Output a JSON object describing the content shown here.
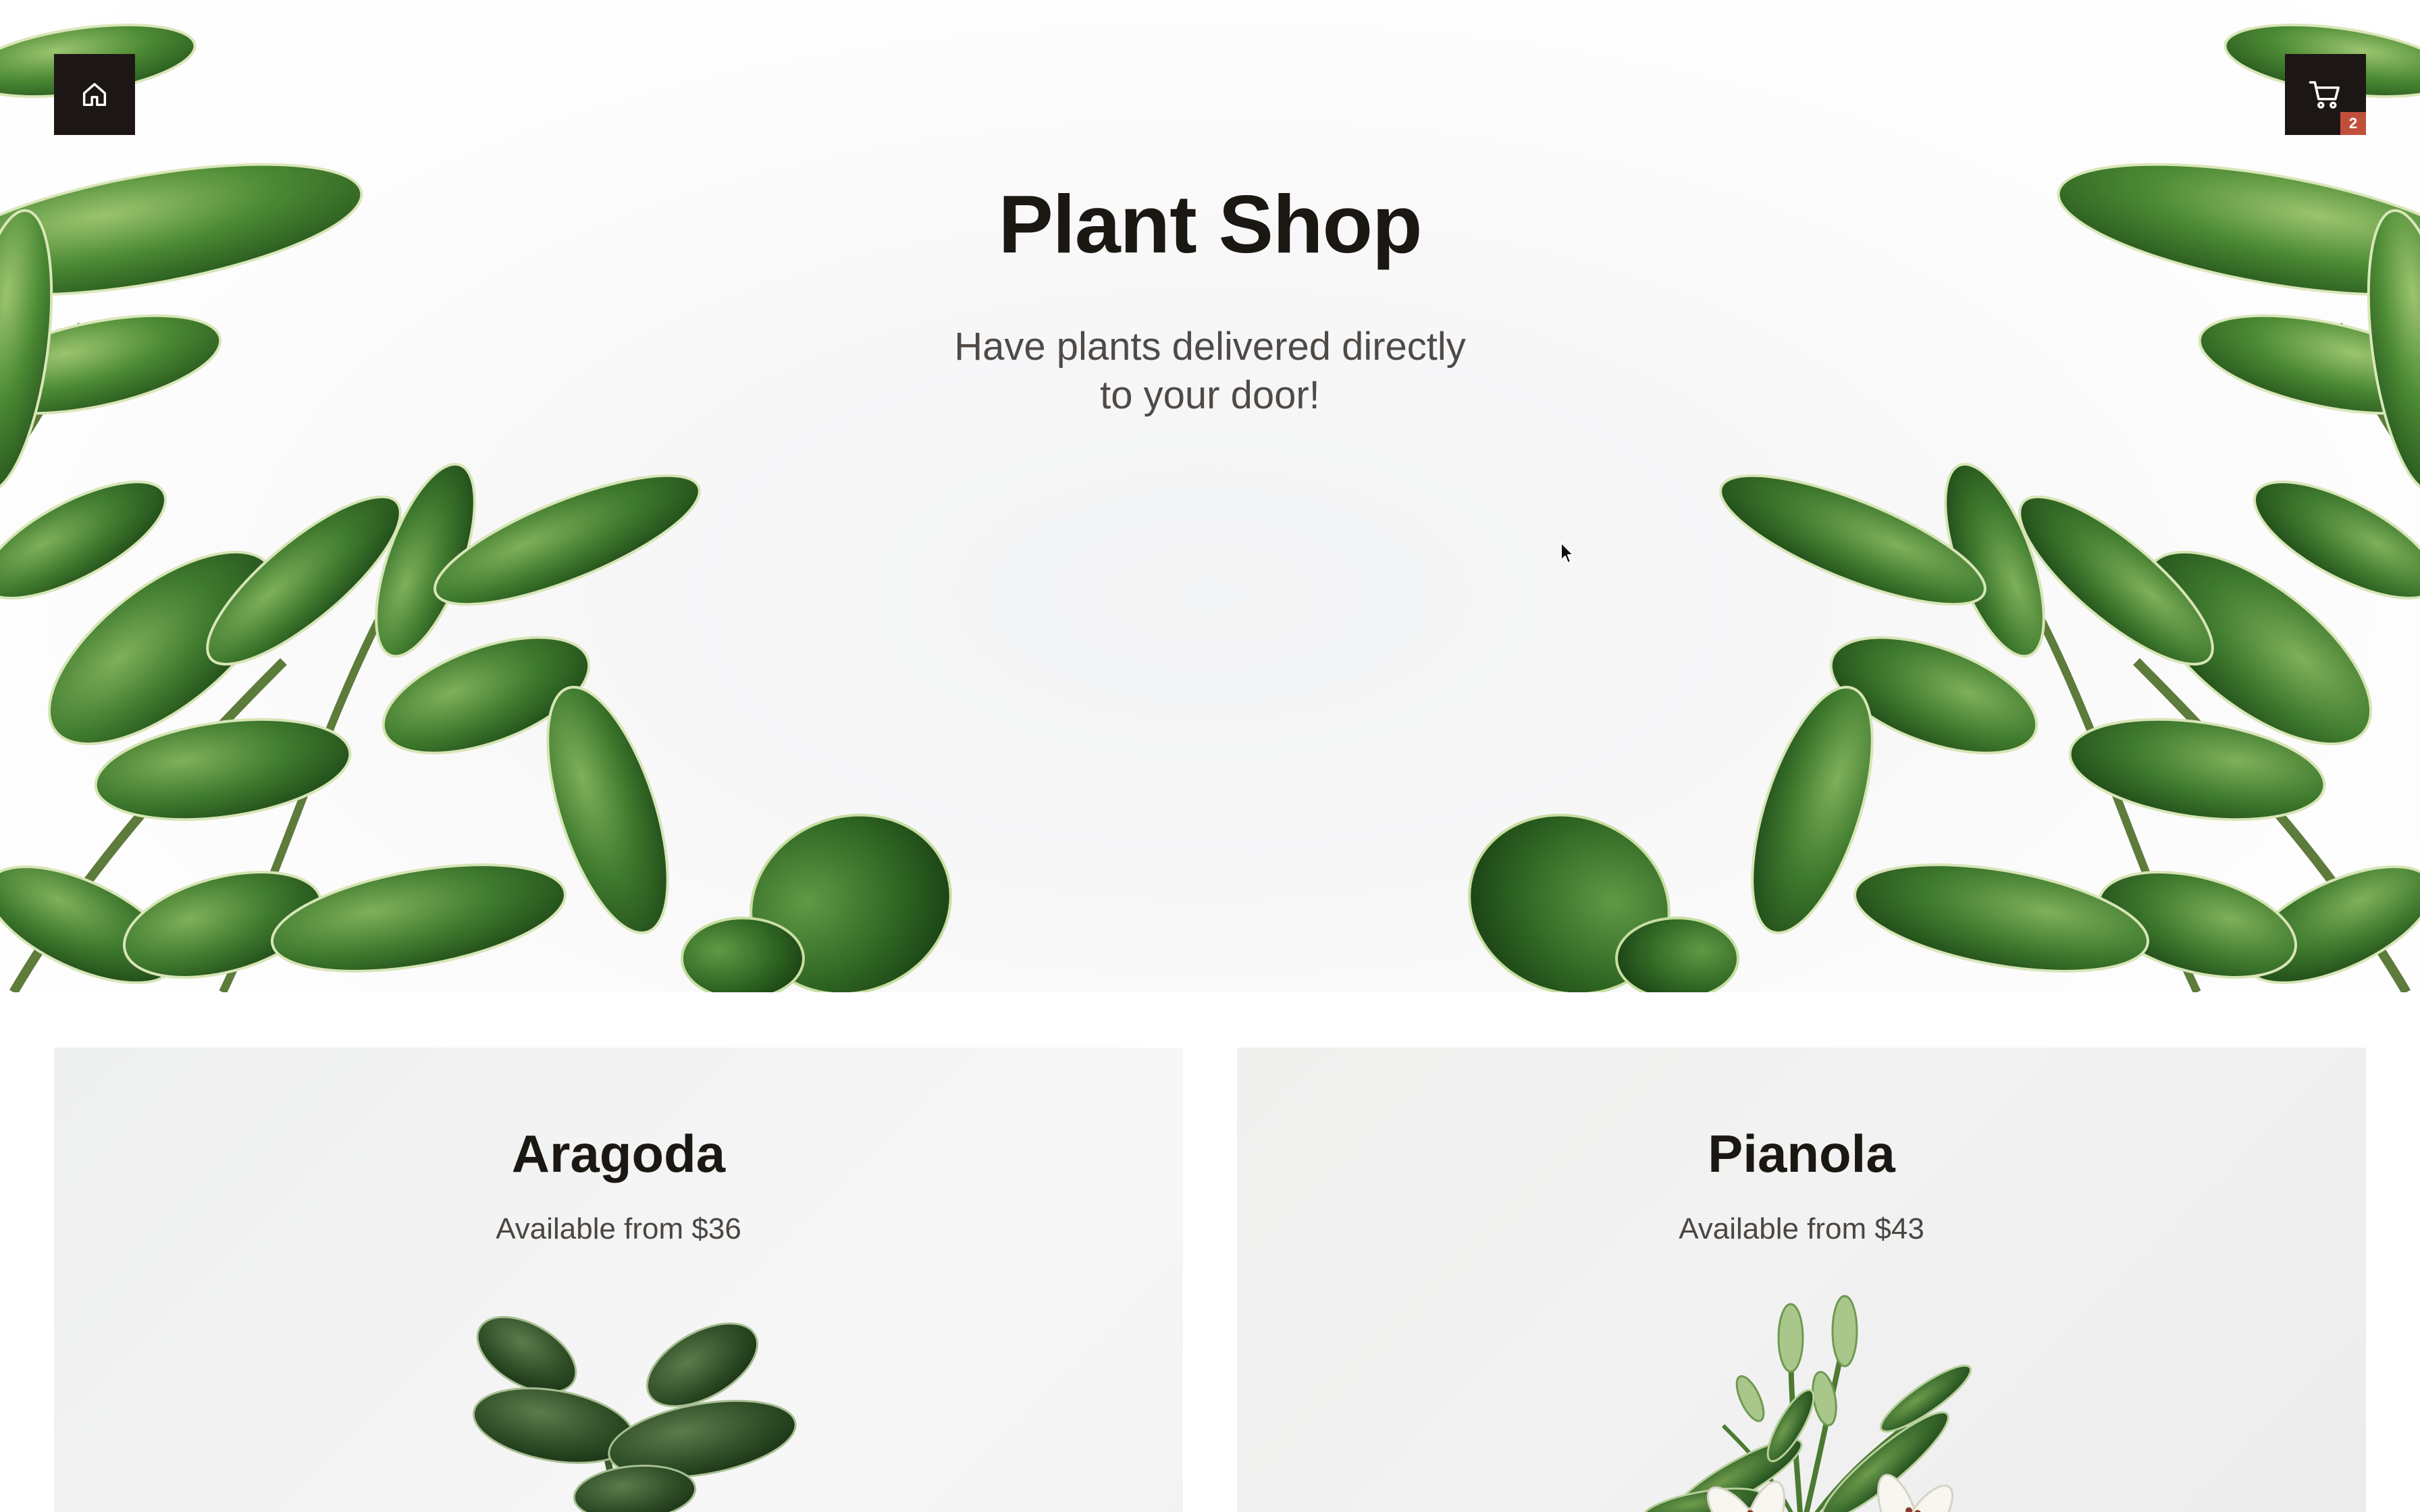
{
  "header": {
    "home_icon": "home-icon",
    "cart_icon": "cart-icon",
    "cart_count": "2"
  },
  "hero": {
    "title": "Plant Shop",
    "subtitle": "Have plants delivered directly to your door!"
  },
  "products": [
    {
      "name": "Aragoda",
      "price_text": "Available from $36"
    },
    {
      "name": "Pianola",
      "price_text": "Available from $43"
    }
  ],
  "colors": {
    "dark": "#1c1714",
    "badge": "#c0503c",
    "leaf": "#3f7a2e",
    "text_muted": "#4f4a46"
  }
}
